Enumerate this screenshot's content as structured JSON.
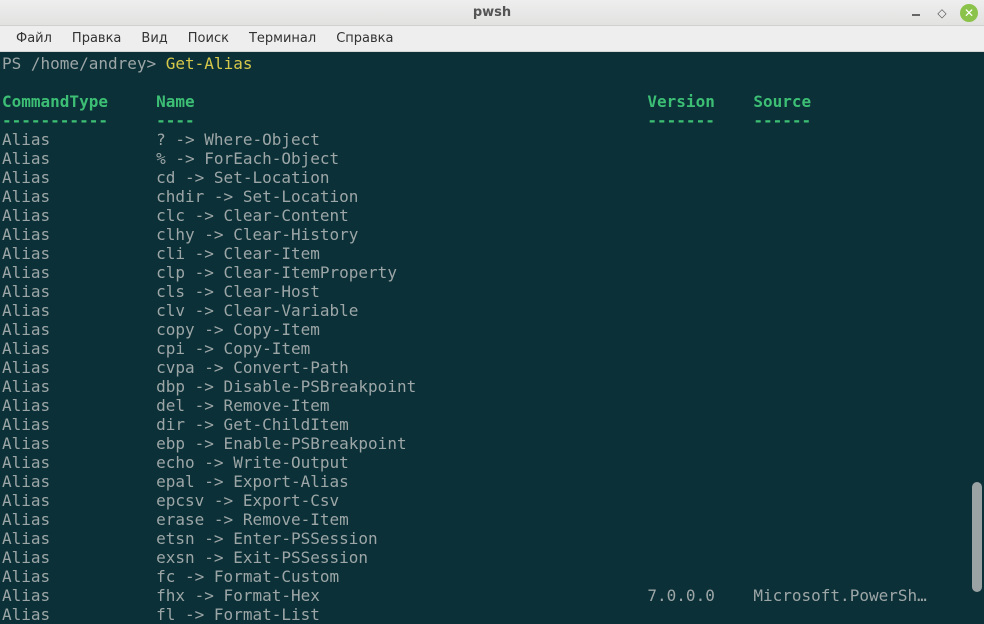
{
  "window": {
    "title": "pwsh"
  },
  "menu": {
    "items": [
      "Файл",
      "Правка",
      "Вид",
      "Поиск",
      "Терминал",
      "Справка"
    ]
  },
  "terminal": {
    "prompt": "PS /home/andrey> ",
    "command": "Get-Alias",
    "headers": {
      "commandType": "CommandType",
      "name": "Name",
      "version": "Version",
      "source": "Source"
    },
    "separators": {
      "commandType": "-----------",
      "name": "----",
      "version": "-------",
      "source": "------"
    },
    "rows": [
      {
        "type": "Alias",
        "name": "? -> Where-Object",
        "version": "",
        "source": ""
      },
      {
        "type": "Alias",
        "name": "% -> ForEach-Object",
        "version": "",
        "source": ""
      },
      {
        "type": "Alias",
        "name": "cd -> Set-Location",
        "version": "",
        "source": ""
      },
      {
        "type": "Alias",
        "name": "chdir -> Set-Location",
        "version": "",
        "source": ""
      },
      {
        "type": "Alias",
        "name": "clc -> Clear-Content",
        "version": "",
        "source": ""
      },
      {
        "type": "Alias",
        "name": "clhy -> Clear-History",
        "version": "",
        "source": ""
      },
      {
        "type": "Alias",
        "name": "cli -> Clear-Item",
        "version": "",
        "source": ""
      },
      {
        "type": "Alias",
        "name": "clp -> Clear-ItemProperty",
        "version": "",
        "source": ""
      },
      {
        "type": "Alias",
        "name": "cls -> Clear-Host",
        "version": "",
        "source": ""
      },
      {
        "type": "Alias",
        "name": "clv -> Clear-Variable",
        "version": "",
        "source": ""
      },
      {
        "type": "Alias",
        "name": "copy -> Copy-Item",
        "version": "",
        "source": ""
      },
      {
        "type": "Alias",
        "name": "cpi -> Copy-Item",
        "version": "",
        "source": ""
      },
      {
        "type": "Alias",
        "name": "cvpa -> Convert-Path",
        "version": "",
        "source": ""
      },
      {
        "type": "Alias",
        "name": "dbp -> Disable-PSBreakpoint",
        "version": "",
        "source": ""
      },
      {
        "type": "Alias",
        "name": "del -> Remove-Item",
        "version": "",
        "source": ""
      },
      {
        "type": "Alias",
        "name": "dir -> Get-ChildItem",
        "version": "",
        "source": ""
      },
      {
        "type": "Alias",
        "name": "ebp -> Enable-PSBreakpoint",
        "version": "",
        "source": ""
      },
      {
        "type": "Alias",
        "name": "echo -> Write-Output",
        "version": "",
        "source": ""
      },
      {
        "type": "Alias",
        "name": "epal -> Export-Alias",
        "version": "",
        "source": ""
      },
      {
        "type": "Alias",
        "name": "epcsv -> Export-Csv",
        "version": "",
        "source": ""
      },
      {
        "type": "Alias",
        "name": "erase -> Remove-Item",
        "version": "",
        "source": ""
      },
      {
        "type": "Alias",
        "name": "etsn -> Enter-PSSession",
        "version": "",
        "source": ""
      },
      {
        "type": "Alias",
        "name": "exsn -> Exit-PSSession",
        "version": "",
        "source": ""
      },
      {
        "type": "Alias",
        "name": "fc -> Format-Custom",
        "version": "",
        "source": ""
      },
      {
        "type": "Alias",
        "name": "fhx -> Format-Hex",
        "version": "7.0.0.0",
        "source": "Microsoft.PowerSh…"
      },
      {
        "type": "Alias",
        "name": "fl -> Format-List",
        "version": "",
        "source": ""
      }
    ]
  }
}
